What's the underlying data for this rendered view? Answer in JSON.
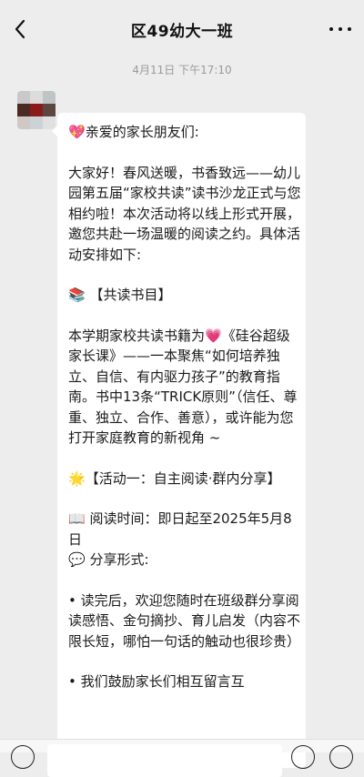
{
  "header": {
    "back_icon": "chevron-left-icon",
    "title": "区49幼大一班",
    "more_icon": "more-horizontal-icon"
  },
  "timestamp": "4月11日 下午17:10",
  "message": {
    "greeting_emoji": "💖",
    "greeting": "亲爱的家长朋友们:",
    "intro": "大家好！春风送暖，书香致远——幼儿园第五届“家校共读”读书沙龙正式与您相约啦！本次活动将以线上形式开展，邀您共赴一场温暖的阅读之约。具体活动安排如下:",
    "section1_emoji": "📚",
    "section1_title": "【共读书目】",
    "book_text_a": "本学期家校共读书籍为",
    "book_emoji": "💗",
    "book_text_b": "《硅谷超级家长课》——一本聚焦“如何培养独立、自信、有内驱力孩子”的教育指南。书中13条“TRICK原则”（信任、尊重、独立、合作、善意），或许能为您打开家庭教育的新视角 ~",
    "section2_emoji": "🌟",
    "section2_title": "【活动一：自主阅读·群内分享】",
    "reading_time_emoji": "📖",
    "reading_time": "阅读时间：即日起至2025年5月8日",
    "share_format_emoji": "💬",
    "share_format": "分享形式:",
    "bullet1": "• 读完后，欢迎您随时在班级群分享阅读感悟、金句摘抄、育儿启发（内容不限长短，哪怕一句话的触动也很珍贵）",
    "bullet2": "• 我们鼓励家长们相互留言互"
  },
  "colors": {
    "background": "#ededed",
    "bubble": "#ffffff",
    "text": "#1a1a1a",
    "timestamp": "#9a9a9a"
  }
}
